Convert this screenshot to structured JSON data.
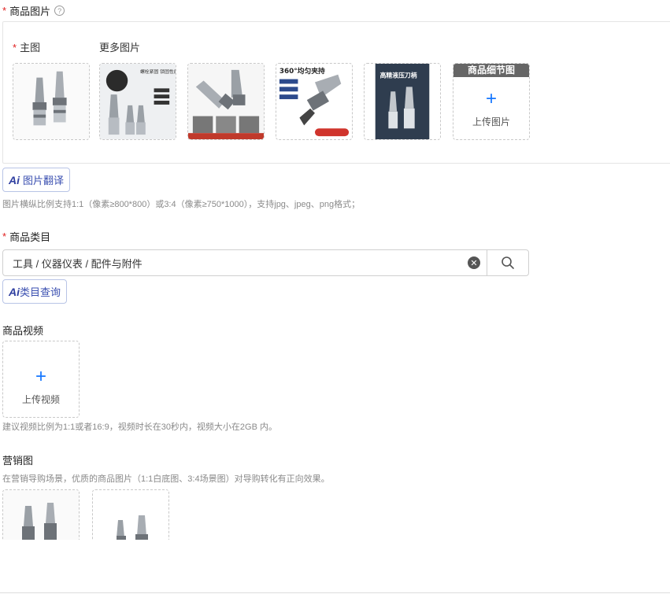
{
  "product_images": {
    "required_mark": "*",
    "title": "商品图片",
    "help_icon": "question-circle-icon",
    "main_label": "主图",
    "more_label": "更多图片",
    "thumbs": [
      {
        "caption": ""
      },
      {
        "caption": "螺栓紧固 锁固性能大提升"
      },
      {
        "caption": ""
      },
      {
        "caption": "360°均匀夹持"
      },
      {
        "caption": "高精液压刀柄"
      }
    ],
    "detail_header": "商品细节图",
    "upload_label": "上传图片"
  },
  "ai_translate": {
    "icon": "Ai",
    "label": "图片翻译"
  },
  "image_hint": "图片横纵比例支持1:1（像素≥800*800）或3:4（像素≥750*1000），支持jpg、jpeg、png格式；",
  "category": {
    "required_mark": "*",
    "title": "商品类目",
    "value": "工具 / 仪器仪表 / 配件与附件",
    "clear_icon": "clear-circle-icon",
    "search_icon": "search-icon"
  },
  "ai_category": {
    "icon": "Ai",
    "label": "类目查询"
  },
  "video": {
    "title": "商品视频",
    "upload_label": "上传视频",
    "hint": "建议视频比例为1:1或者16:9，视频时长在30秒内，视频大小在2GB 内。"
  },
  "marketing": {
    "title": "营销图",
    "hint": "在营销导购场景，优质的商品图片（1:1白底图、3:4场景图）对导购转化有正向效果。"
  },
  "colors": {
    "accent": "#1677ff",
    "required": "#e02020",
    "ai": "#3a4fb0"
  }
}
